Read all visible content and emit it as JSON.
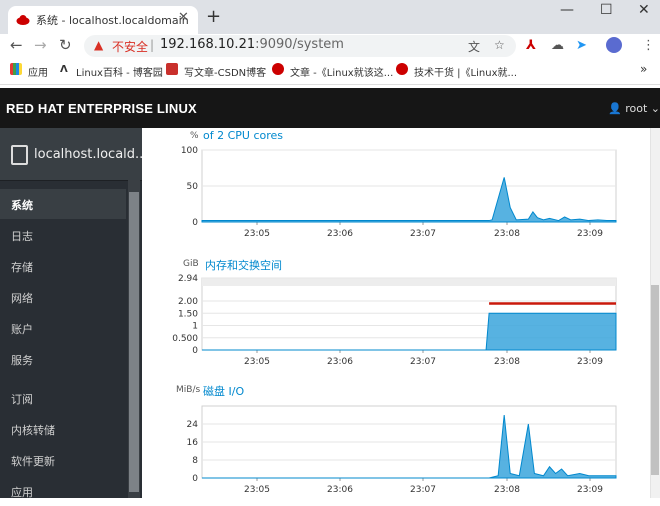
{
  "browser": {
    "tab_title": "系统 - localhost.localdomain",
    "close_glyph": "✕",
    "new_tab_glyph": "+",
    "window_minimize": "—",
    "window_maximize": "☐",
    "window_close": "✕",
    "nav_back": "←",
    "nav_forward": "→",
    "nav_reload": "↻",
    "security_warning": "不安全",
    "url_host": "192.168.10.21",
    "url_port_path": ":9090/system",
    "bookmarks": [
      "应用",
      "Linux百科 - 博客园",
      "写文章-CSDN博客",
      "文章 -《Linux就该这...",
      "技术干货 |《Linux就...",
      "»"
    ]
  },
  "cockpit": {
    "brand": "RED HAT ENTERPRISE LINUX",
    "user": "root",
    "hostname": "localhost.locald...",
    "nav_items": [
      "系统",
      "日志",
      "存储",
      "网络",
      "账户",
      "服务",
      "订阅",
      "内核转储",
      "软件更新",
      "应用"
    ],
    "active_nav": "系统"
  },
  "colors": {
    "accent": "#0088ce",
    "series": "#39a5dc",
    "swap_line": "#c9190b",
    "masthead": "#161616",
    "sidebar": "#292e34"
  },
  "chart_data": [
    {
      "type": "area",
      "title": "of 2 CPU cores",
      "unit_label": "%",
      "y_ticks": [
        "100",
        "50",
        "0"
      ],
      "x_ticks": [
        "23:05",
        "23:06",
        "23:07",
        "23:08",
        "23:09"
      ],
      "ylim": [
        0,
        100
      ],
      "series": [
        {
          "values": [
            [
              0,
              2
            ],
            [
              100,
              2
            ],
            [
              190,
              2
            ],
            [
              192,
              3
            ],
            [
              200,
              62
            ],
            [
              204,
              20
            ],
            [
              208,
              3
            ],
            [
              216,
              4
            ],
            [
              219,
              14
            ],
            [
              222,
              6
            ],
            [
              226,
              3
            ],
            [
              230,
              5
            ],
            [
              236,
              2
            ],
            [
              240,
              7
            ],
            [
              244,
              3
            ],
            [
              250,
              4
            ],
            [
              256,
              2
            ],
            [
              262,
              3
            ],
            [
              268,
              2
            ],
            [
              274,
              2
            ]
          ]
        }
      ]
    },
    {
      "type": "area",
      "title": "内存和交换空间",
      "unit_label": "GiB",
      "y_ticks": [
        "2.94",
        "2.00",
        "1.50",
        "1",
        "0.500",
        "0"
      ],
      "x_ticks": [
        "23:05",
        "23:06",
        "23:07",
        "23:08",
        "23:09"
      ],
      "ylim": [
        0,
        2.94
      ],
      "series": [
        {
          "values": [
            [
              0,
              0
            ],
            [
              188,
              0
            ],
            [
              190,
              1.5
            ],
            [
              274,
              1.5
            ]
          ]
        },
        {
          "values": [
            [
              190,
              1.9
            ],
            [
              274,
              1.9
            ]
          ]
        }
      ]
    },
    {
      "type": "area",
      "title": "磁盘 I/O",
      "unit_label": "MiB/s",
      "y_ticks": [
        "24",
        "16",
        "8",
        "0"
      ],
      "x_ticks": [
        "23:05",
        "23:06",
        "23:07",
        "23:08",
        "23:09"
      ],
      "ylim": [
        0,
        32
      ],
      "series": [
        {
          "values": [
            [
              0,
              0
            ],
            [
              190,
              0
            ],
            [
              196,
              1
            ],
            [
              200,
              28
            ],
            [
              204,
              2
            ],
            [
              210,
              1
            ],
            [
              216,
              24
            ],
            [
              220,
              2
            ],
            [
              226,
              1
            ],
            [
              230,
              5
            ],
            [
              234,
              2
            ],
            [
              238,
              4
            ],
            [
              242,
              1
            ],
            [
              250,
              2
            ],
            [
              256,
              1
            ],
            [
              262,
              1
            ],
            [
              274,
              1
            ]
          ]
        }
      ]
    }
  ]
}
